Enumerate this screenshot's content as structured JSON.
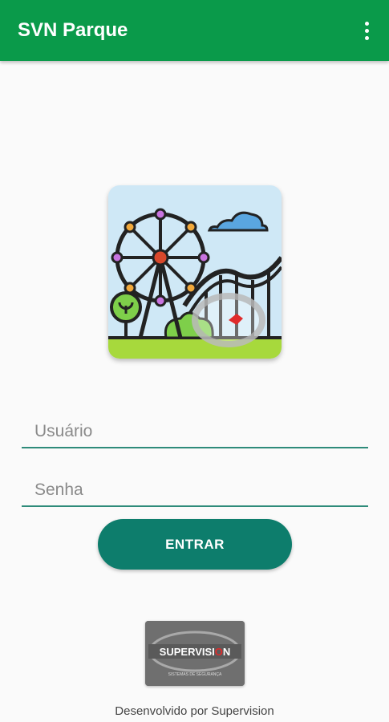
{
  "appbar": {
    "title": "SVN Parque",
    "menu_icon": "more-vert-icon"
  },
  "app_icon": {
    "icon": "amusement-park-icon",
    "colors": {
      "sky": "#cfe8f6",
      "grass": "#a7d93c",
      "outline": "#222222",
      "hub": "#d9482b",
      "bulb_purple": "#c874e0",
      "bulb_orange": "#f2a93b"
    }
  },
  "login": {
    "username_placeholder": "Usuário",
    "username_value": "",
    "password_placeholder": "Senha",
    "password_value": "",
    "submit_label": "ENTRAR"
  },
  "logo": {
    "wordmark": "SUPERVISION",
    "tagline": "SISTEMAS DE SEGURANÇA"
  },
  "footer": {
    "text": "Desenvolvido por Supervision"
  },
  "colors": {
    "appbar": "#0a9a4a",
    "accent": "#0d7d6c",
    "underline": "#2e8b7a"
  }
}
